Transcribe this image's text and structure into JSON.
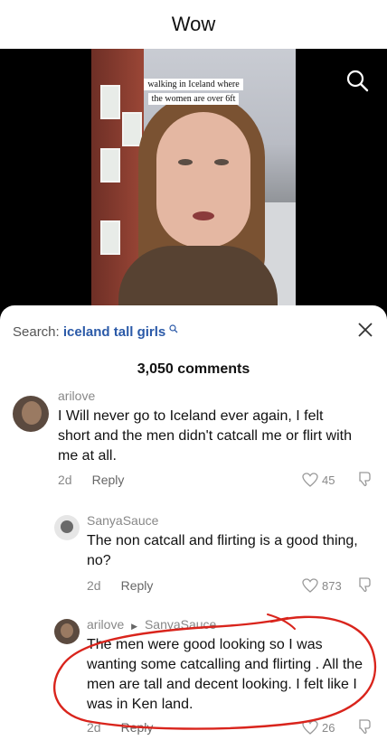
{
  "meme": {
    "title": "Wow"
  },
  "video": {
    "caption_line1": "walking in Iceland where",
    "caption_line2": "the women are over 6ft"
  },
  "search": {
    "prefix": "Search:",
    "query": "iceland tall girls"
  },
  "comments_header": "3,050 comments",
  "comments": [
    {
      "username": "arilove",
      "text": "I Will never go to Iceland ever again, I felt short and the men didn't catcall me or flirt with me at all.",
      "age": "2d",
      "reply_label": "Reply",
      "likes": "45"
    },
    {
      "username": "SanyaSauce",
      "text": "The non catcall and flirting is a good thing, no?",
      "age": "2d",
      "reply_label": "Reply",
      "likes": "873"
    },
    {
      "username": "arilove",
      "reply_to": "SanyaSauce",
      "text": "The men were good looking so I was wanting some catcalling and flirting . All the men are tall and decent looking. I felt like I was in Ken land.",
      "age": "2d",
      "reply_label": "Reply",
      "likes": "26"
    }
  ],
  "colors": {
    "annotation": "#d9241c",
    "query": "#2b5aa8",
    "muted": "#888888"
  }
}
